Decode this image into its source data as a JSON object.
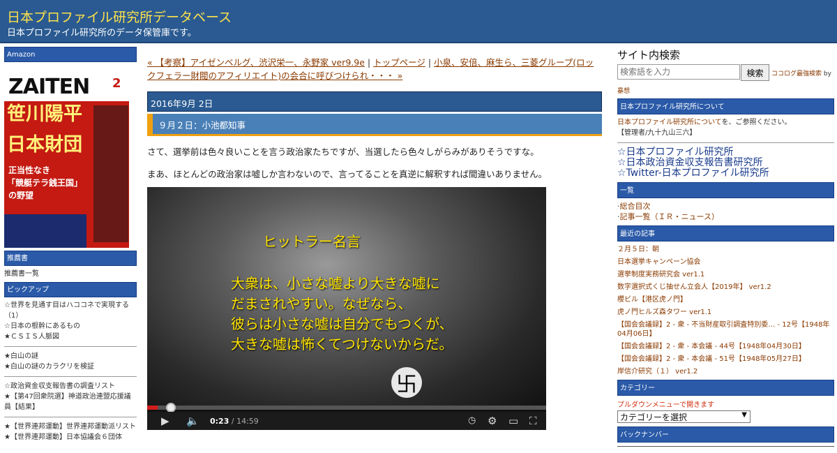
{
  "header": {
    "title": "日本プロファイル研究所データベース",
    "description": "日本プロファイル研究所のデータ保管庫です。"
  },
  "left": {
    "amazon_title": "Amazon",
    "book": {
      "magazine": "ZAITEN",
      "issue": "2",
      "headline_1": "笹川陽平",
      "headline_2": "日本財団",
      "subhead_1": "正当性なき",
      "subhead_2": "「競艇テラ銭王国」",
      "subhead_3": "の野望"
    },
    "recommend_title": "推薦書",
    "recommend_link": "推薦書一覧",
    "pickup_title": "ピックアップ",
    "pickup_groups": [
      [
        "☆世界を見通す目はハココネで実現する（1）",
        "☆日本の根幹にあるもの",
        "★ＣＳＩＳ人脈図"
      ],
      [
        "★白山の謎",
        "★白山の謎のカラクリを検証"
      ],
      [
        "☆政治資金収支報告書の調査リスト",
        "★【第47回衆院選】神道政治連盟応援議員【結果】"
      ],
      [
        "★【世界連邦運動】世界連邦運動派リスト",
        "★【世界連邦運動】日本協議会６団体"
      ]
    ]
  },
  "main": {
    "nav_prev": "« 【考察】アイゼンベルグ、渋沢栄一、永野家 ver9.9e",
    "nav_sep1": " | ",
    "nav_top": "トップページ",
    "nav_sep2": " | ",
    "nav_next": "小泉、安倍、麻生ら、三菱グループ(ロックフェラー財閥のアフィリエイト)の会合に呼びつけられ・・・ »",
    "date": "2016年9月 2日",
    "entry_title": "９月２日：小池都知事",
    "para1": "さて、選挙前は色々良いことを言う政治家たちですが、当選したら色々しがらみがありそうですな。",
    "para2": "まあ、ほとんどの政治家は嘘しか言わないので、言ってることを真逆に解釈すれば間違いありません。",
    "video": {
      "caption_title": "ヒットラー名言",
      "caption_lines": [
        "大衆は、小さな嘘より大きな嘘に",
        "だまされやすい。なぜなら、",
        "彼らは小さな嘘は自分でもつくが、",
        "大きな嘘は怖くてつけないからだ。"
      ],
      "current_time": "0:23",
      "time_sep": " / ",
      "duration": "14:59",
      "progress": 0.026
    }
  },
  "right": {
    "search_title": "サイト内検索",
    "search_placeholder": "検索語を入力",
    "search_button": "検索",
    "powered_link": "ココログ最強検索",
    "powered_by": " by",
    "powered_author": "暴想",
    "about_title": "日本プロファイル研究所について",
    "about_link": "日本プロファイル研究所について",
    "about_text": "を、ご参照ください。",
    "about_admin": "【管理者/九十九山三六】",
    "big_links": [
      "☆日本プロファイル研究所",
      "☆日本政治資金収支報告書研究所",
      "☆Twitter-日本プロファイル研究所"
    ],
    "list_title": "一覧",
    "list_items": [
      "総合目次",
      "記事一覧（ＩＲ・ニュース）"
    ],
    "recent_title": "最近の記事",
    "recent_items": [
      "２月５日：朝",
      "日本選挙キャンペーン協会",
      "選挙制度実務研究会 ver1.1",
      "数字選択式くじ抽せん立会人【2019年】 ver1.2",
      "櫻ビル【港区虎ノ門】",
      "虎ノ門ヒルズ森タワー ver1.1",
      "【国会会議録】2 - 衆 - 不当財産取引調査特別委… - 12号【1948年04月06日】",
      "【国会会議録】2 - 衆 - 本会議 - 44号【1948年04月30日】",
      "【国会会議録】2 - 衆 - 本会議 - 51号【1948年05月27日】",
      "岸信介研究（１） ver1.2"
    ],
    "category_title": "カテゴリー",
    "category_note": "プルダウンメニューで開きます",
    "category_select": "カテゴリーを選択",
    "backnumber_title": "バックナンバー"
  },
  "colors": {
    "header_bg": "#2a5a91",
    "title_yellow": "#ffe24a",
    "accent_orange": "#f0a010",
    "sidebar_head": "#2a5aa8",
    "link_brown": "#8a3a00"
  }
}
